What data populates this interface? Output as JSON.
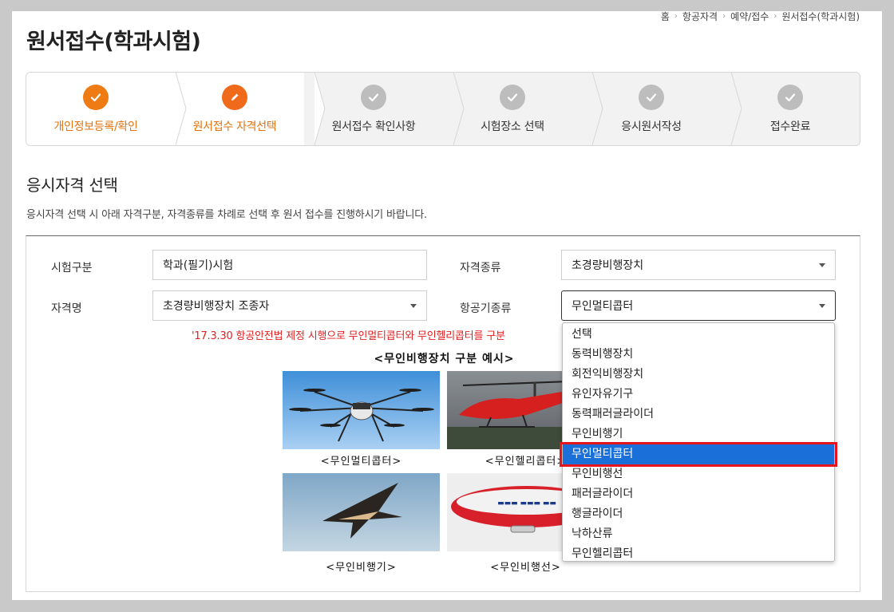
{
  "breadcrumb": [
    "홈",
    "항공자격",
    "예약/접수",
    "원서접수(학과시험)"
  ],
  "page_title": "원서접수(학과시험)",
  "steps": [
    {
      "label": "개인정보등록/확인",
      "state": "done"
    },
    {
      "label": "원서접수 자격선택",
      "state": "current"
    },
    {
      "label": "원서접수 확인사항",
      "state": "todo"
    },
    {
      "label": "시험장소 선택",
      "state": "todo"
    },
    {
      "label": "응시원서작성",
      "state": "todo"
    },
    {
      "label": "접수완료",
      "state": "todo"
    }
  ],
  "section": {
    "title": "응시자격 선택",
    "description": "응시자격 선택 시 아래 자격구분, 자격종류를 차례로 선택 후 원서 접수를 진행하시기 바랍니다."
  },
  "form": {
    "exam_type_label": "시험구분",
    "exam_type_value": "학과(필기)시험",
    "qual_kind_label": "자격종류",
    "qual_kind_value": "초경량비행장치",
    "qual_name_label": "자격명",
    "qual_name_value": "초경량비행장치 조종자",
    "aircraft_label": "항공기종류",
    "aircraft_value": "무인멀티콥터"
  },
  "notice": "'17.3.30 항공안전법 제정 시행으로 무인멀티콥터와 무인헬리콥터를 구분",
  "examples": {
    "title": "<무인비행장치 구분 예시>",
    "captions": [
      "<무인멀티콥터>",
      "<무인헬리콥터>",
      "<무인비행기>",
      "<무인비행선>"
    ]
  },
  "dropdown": {
    "options": [
      "선택",
      "동력비행장치",
      "회전익비행장치",
      "유인자유기구",
      "동력패러글라이더",
      "무인비행기",
      "무인멀티콥터",
      "무인비행선",
      "패러글라이더",
      "행글라이더",
      "낙하산류",
      "무인헬리콥터"
    ],
    "selected": "무인멀티콥터"
  },
  "colors": {
    "accent": "#ef7b15",
    "selected": "#1a6fd8",
    "highlight": "#e8141c",
    "notice": "#e02020"
  }
}
